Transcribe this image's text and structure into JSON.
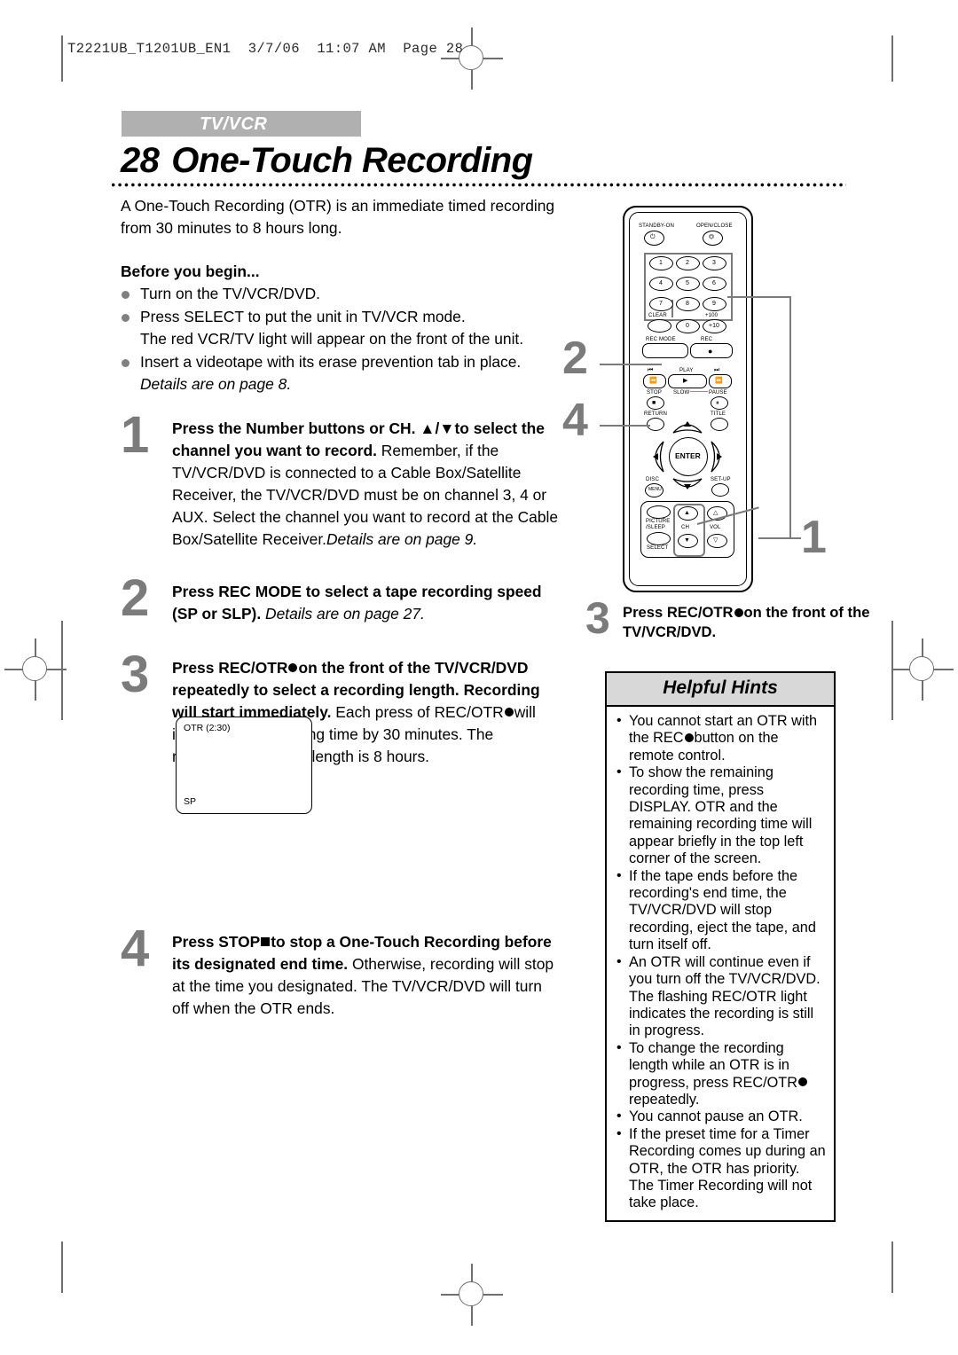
{
  "print_slug": "T2221UB_T1201UB_EN1  3/7/06  11:07 AM  Page 28",
  "header": {
    "section_band": "TV/VCR",
    "page_number": "28",
    "title": "One-Touch Recording"
  },
  "left_column": {
    "intro": "A One-Touch Recording (OTR) is an immediate timed recording from 30 minutes to 8 hours long.",
    "before_heading": "Before you begin...",
    "before_items": [
      {
        "text": "Turn on the TV/VCR/DVD.",
        "sub": ""
      },
      {
        "text": "Press SELECT to put the unit in TV/VCR mode.",
        "sub": "The red VCR/TV light will appear on the front of the unit."
      },
      {
        "text": "Insert a videotape with its erase prevention tab in place.",
        "sub": "Details are on page 8."
      }
    ],
    "steps": [
      {
        "number": "1",
        "bold": "Press the Number buttons or CH. ▲/▼to select the channel you want to record.",
        "body": "Remember, if the TV/VCR/DVD is connected to a Cable Box/Satellite Receiver, the TV/VCR/DVD must be on channel 3, 4 or AUX.",
        "body2": "Select the channel you want to record at the Cable Box/Satellite Receiver.",
        "body2_italic": "Details are on page 9."
      },
      {
        "number": "2",
        "bold": "Press REC MODE to select a tape recording speed (SP or SLP).",
        "body_italic": "Details are on page 27."
      },
      {
        "number": "3",
        "bold_a": "Press REC/OTR",
        "bold_b": "on the front of the TV/VCR/DVD repeatedly to select a recording length. Recording will start immediately.",
        "body_a": "Each press of REC/OTR",
        "body_b": "will increase the recording time by 30 minutes. The maximum recording length is 8 hours."
      },
      {
        "number": "4",
        "bold_a": "Press STOP",
        "bold_b": "to stop a One-Touch Recording before its designated end time.",
        "body": "Otherwise, recording will stop at the time you designated. The TV/VCR/DVD will turn off when the OTR ends."
      }
    ],
    "osd_screen": {
      "top_left": "OTR (2:30)",
      "bottom_left": "SP"
    }
  },
  "right_column": {
    "step3": {
      "number": "3",
      "text_a": "Press REC/OTR",
      "text_b": "on the front of the TV/VCR/DVD."
    },
    "hints_title": "Helpful Hints",
    "hints": [
      {
        "a": "You cannot start an OTR with the REC",
        "b": "button on the remote control."
      },
      {
        "a": "To show the remaining recording time, press DISPLAY. OTR and the remaining recording time will appear briefly in the top left corner of the screen.",
        "b": ""
      },
      {
        "a": "If the tape ends before the recording's end time, the TV/VCR/DVD will stop recording, eject the tape, and turn itself off.",
        "b": ""
      },
      {
        "a": "An OTR will continue even if you turn off the TV/VCR/DVD. The flashing REC/OTR light indicates the recording is still in progress.",
        "b": ""
      },
      {
        "a": "To change the recording length while an OTR is in progress, press  REC/OTR",
        "b": "repeatedly."
      },
      {
        "a": "You cannot pause an OTR.",
        "b": ""
      },
      {
        "a": "If the preset time for a Timer Recording comes up during an OTR, the OTR has priority. The Timer Recording will not take place.",
        "b": ""
      }
    ]
  },
  "remote": {
    "labels": {
      "standby": "STANDBY-ON",
      "open_close": "OPEN/CLOSE",
      "clear": "CLEAR",
      "plus100": "+100",
      "plus10": "+10",
      "rec_mode": "REC MODE",
      "rec": "REC",
      "play": "PLAY",
      "stop": "STOP",
      "slow": "SLOW",
      "pause": "PAUSE",
      "return": "RETURN",
      "title": "TITLE",
      "enter": "ENTER",
      "disc": "DISC",
      "setup": "SET-UP",
      "picture_sleep_1": "PICTURE",
      "picture_sleep_2": "/SLEEP",
      "select": "SELECT",
      "ch": "CH",
      "vol": "VOL"
    },
    "keypad": [
      "1",
      "2",
      "3",
      "4",
      "5",
      "6",
      "7",
      "8",
      "9",
      "0"
    ],
    "callouts": {
      "keypad_ch": "1",
      "rec_mode": "2",
      "stop": "4"
    }
  },
  "colors": {
    "band_gray": "#b0b0b0",
    "callout_gray": "#7b7b7b",
    "bullet_gray": "#808080",
    "hint_header": "#d8d8d8"
  }
}
